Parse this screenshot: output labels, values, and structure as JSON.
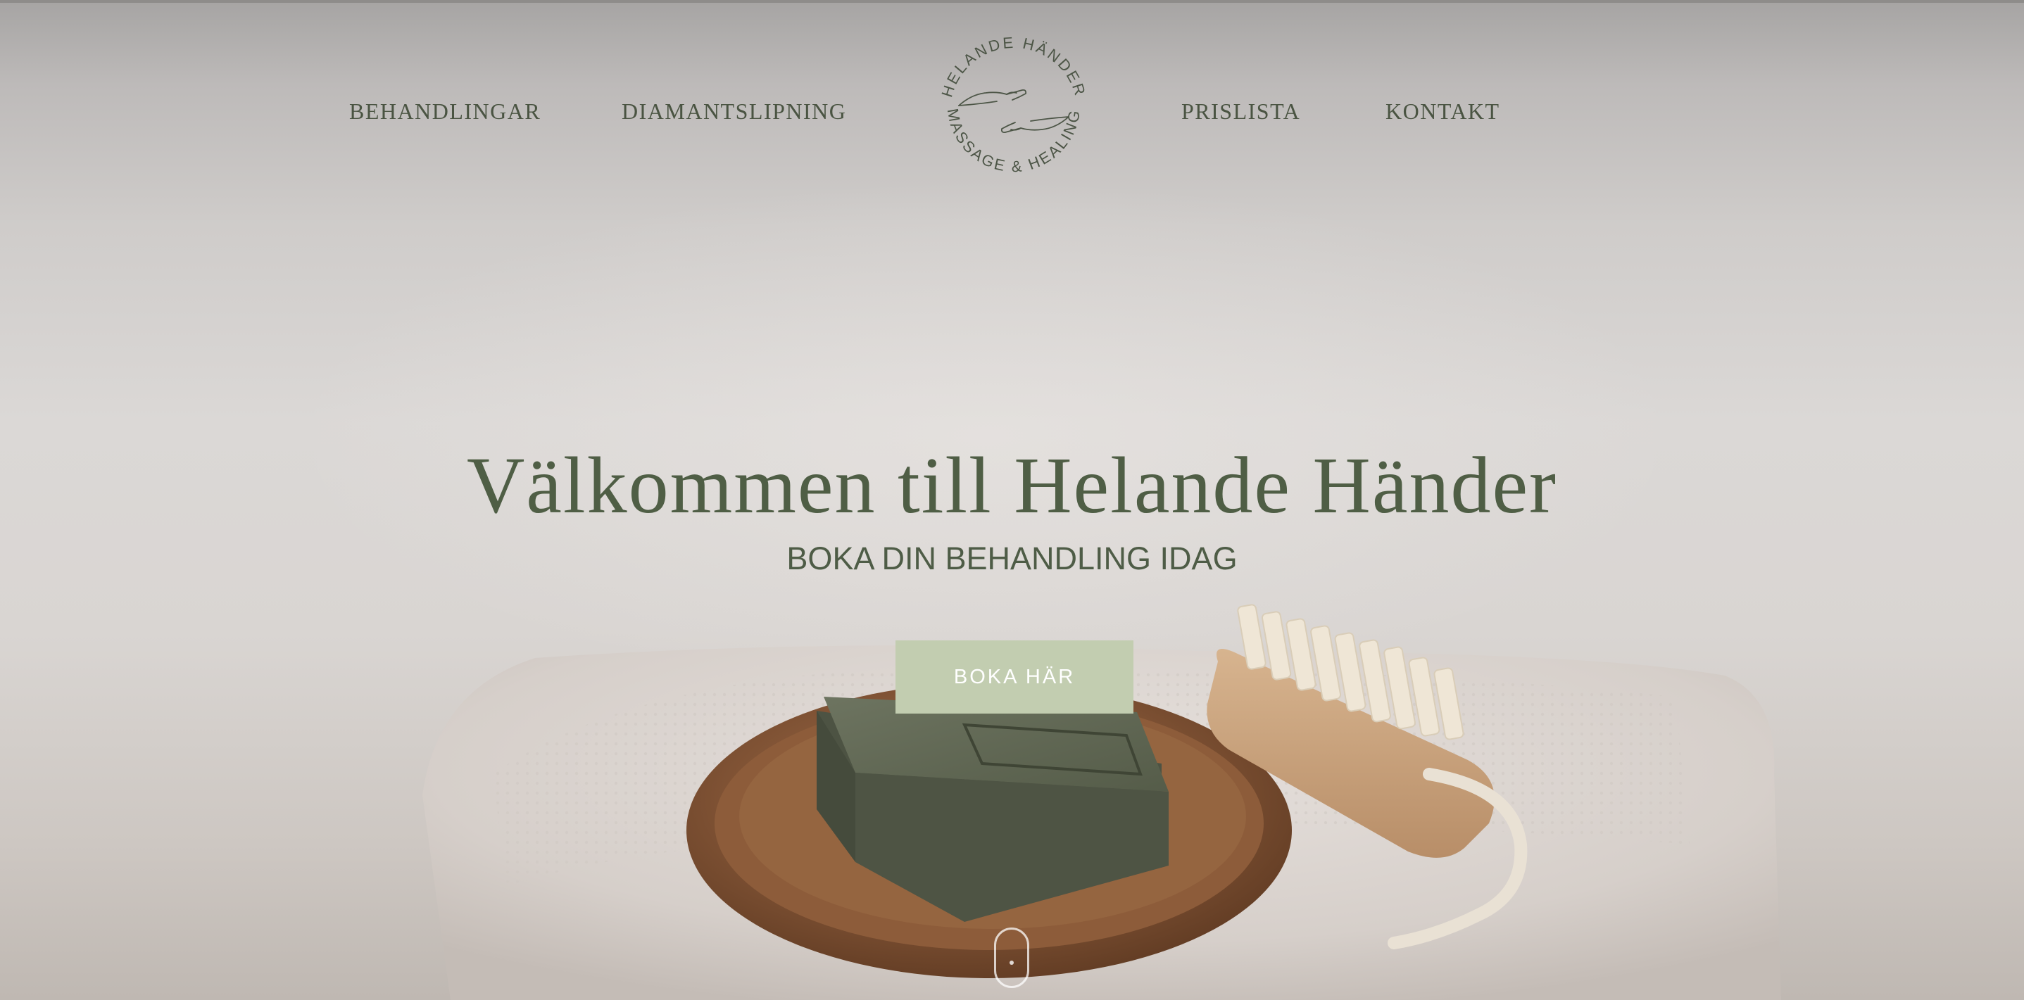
{
  "nav": {
    "items": [
      {
        "label": "BEHANDLINGAR"
      },
      {
        "label": "DIAMANTSLIPNING"
      },
      {
        "label": "PRISLISTA"
      },
      {
        "label": "KONTAKT"
      }
    ]
  },
  "logo": {
    "top_text": "HELANDE HÄNDER",
    "bottom_text": "MASSAGE & HEALING",
    "icon": "hands-icon"
  },
  "hero": {
    "headline": "Välkommen till Helande Händer",
    "subheadline": "BOKA DIN BEHANDLING IDAG",
    "cta_label": "BOKA HÄR"
  },
  "colors": {
    "brand_green": "#4f5e45",
    "button_bg": "#c2cdb0",
    "button_text": "#ffffff"
  }
}
